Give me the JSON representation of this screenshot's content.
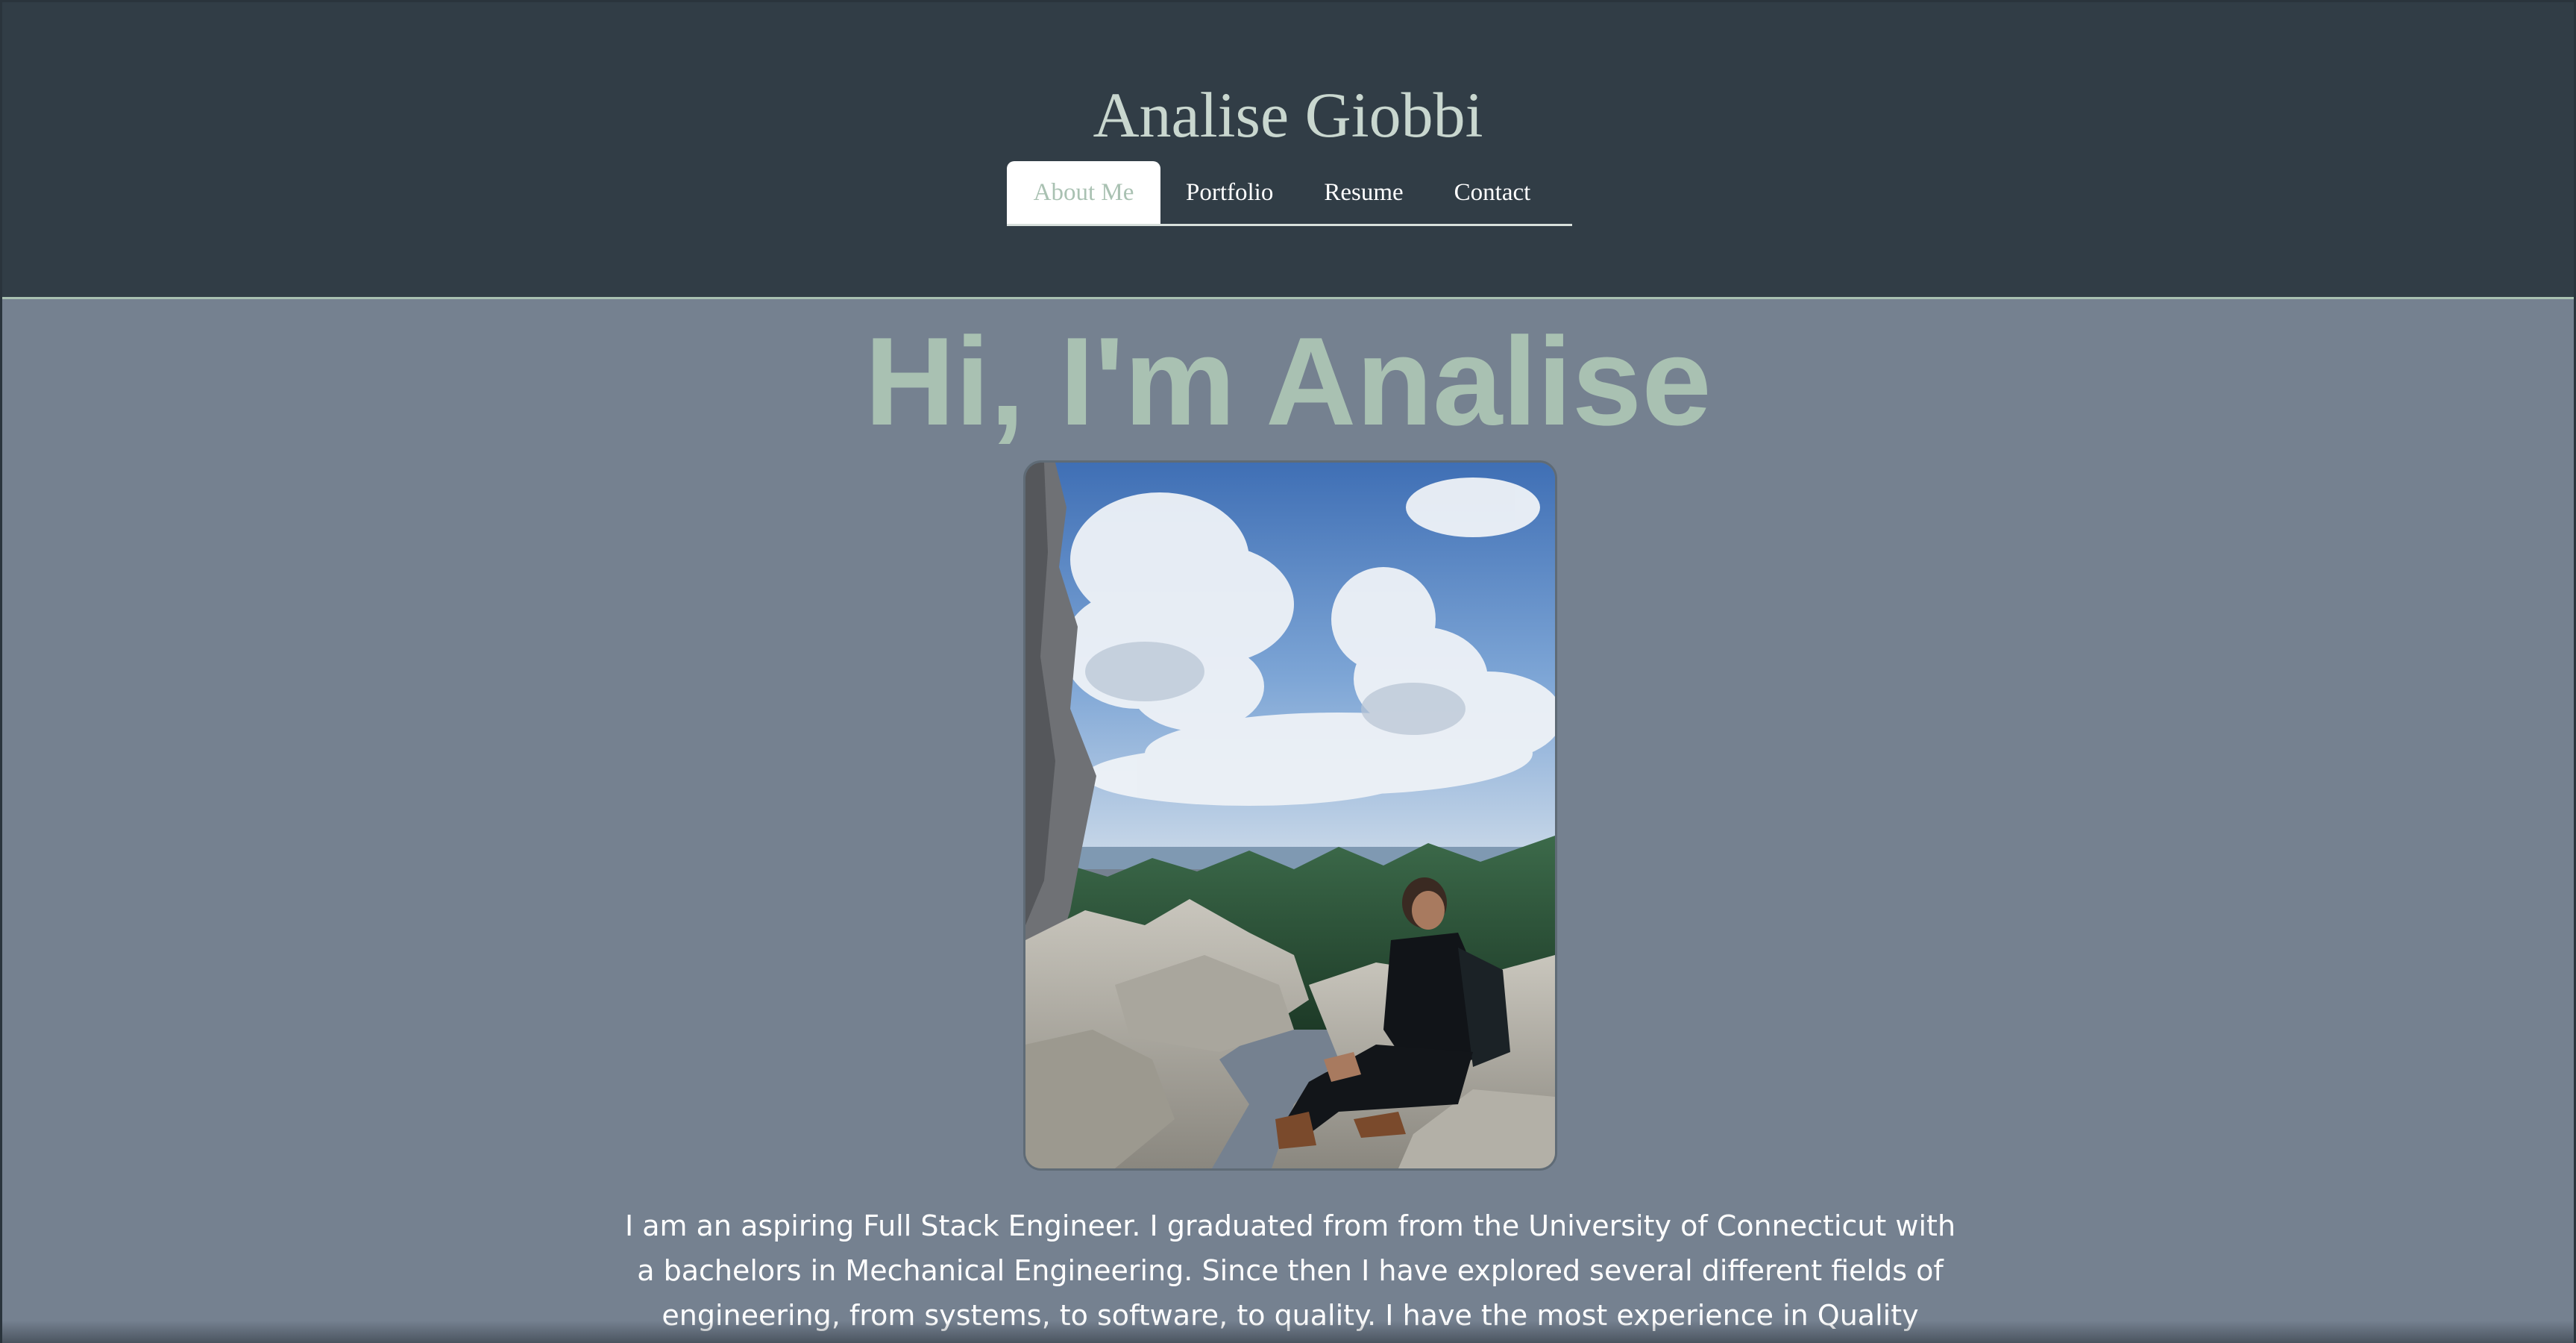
{
  "header": {
    "site_title": "Analise Giobbi"
  },
  "nav": {
    "tabs": [
      {
        "label": "About Me",
        "active": true
      },
      {
        "label": "Portfolio",
        "active": false
      },
      {
        "label": "Resume",
        "active": false
      },
      {
        "label": "Contact",
        "active": false
      }
    ]
  },
  "main": {
    "heading": "Hi, I'm Analise",
    "about_text": "I am an aspiring Full Stack Engineer. I graduated from from the University of Connecticut with a bachelors in Mechanical Engineering. Since then I have explored several different fields of engineering, from systems, to software, to quality. I have the most experience in Quality"
  },
  "colors": {
    "header_bg": "#313d46",
    "page_bg": "#758190",
    "accent": "#a9c1b2",
    "title_text": "#c9d7cf"
  }
}
